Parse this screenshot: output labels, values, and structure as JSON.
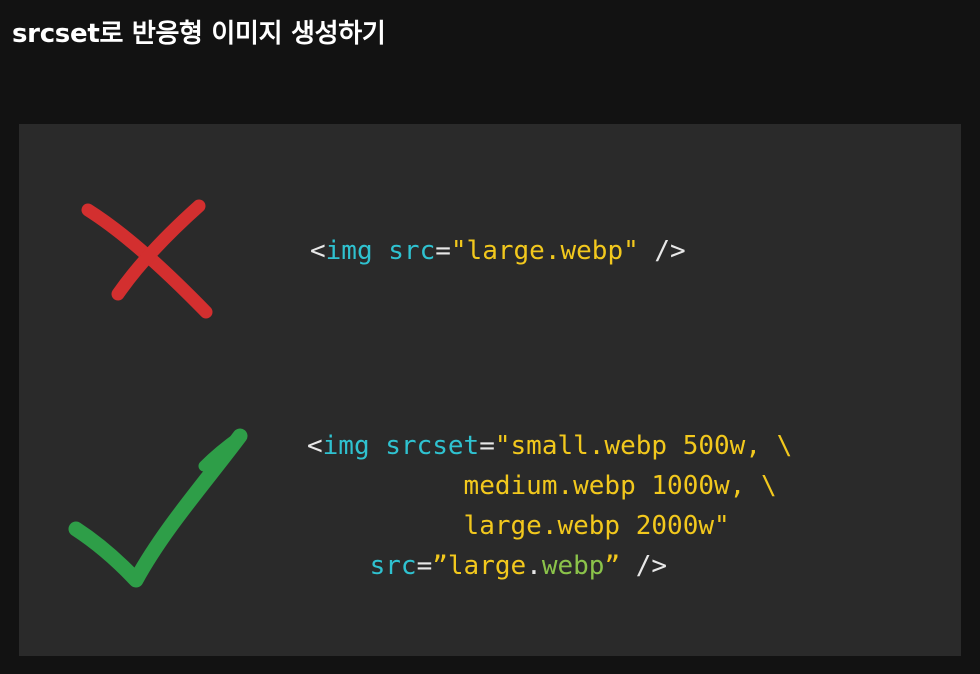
{
  "page": {
    "title": "srcset로 반응형 이미지 생성하기"
  },
  "slide": {
    "background": "#2a2a2a",
    "bad_example": {
      "icon": "red-x-icon",
      "color": "#d32f2f",
      "line1": {
        "open": "<",
        "tag": "img",
        "space": " ",
        "attr": "src",
        "eq": "=",
        "value": "\"large.webp\"",
        "close": " />"
      }
    },
    "good_example": {
      "icon": "green-check-icon",
      "color": "#2e9e48",
      "line1": {
        "open": "<",
        "tag": "img",
        "space": " ",
        "attr": "srcset",
        "eq": "=",
        "value": "\"small.webp 500w, \\"
      },
      "line2": {
        "indent": "          ",
        "value": "medium.webp 1000w, \\"
      },
      "line3": {
        "indent": "          ",
        "value": "large.webp 2000w\""
      },
      "line4": {
        "indent": "    ",
        "attr": "src",
        "eq": "=",
        "quote_open": "”large",
        "dot": ".",
        "ext": "webp",
        "quote_close": "”",
        "close": " />"
      }
    }
  },
  "colors": {
    "page_background": "#121212",
    "tag": "#2fc2d0",
    "string": "#f2c81d",
    "punctuation": "#e8e8e8",
    "highlight": "#8bc34a"
  }
}
